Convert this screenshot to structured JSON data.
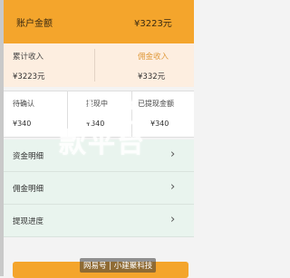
{
  "account": {
    "balance_label": "账户金额",
    "balance_value": "¥3223元"
  },
  "income": {
    "cumulative_label": "累计收入",
    "commission_label": "佣金收入",
    "cumulative_value": "¥3223元",
    "commission_value": "¥332元"
  },
  "status": [
    {
      "title": "待确认",
      "value": "¥340"
    },
    {
      "title": "提现中",
      "value": "¥340"
    },
    {
      "title": "已提现金额",
      "value": "¥340"
    }
  ],
  "menu": [
    {
      "label": "资金明细"
    },
    {
      "label": "佣金明细"
    },
    {
      "label": "提现进度"
    }
  ],
  "watermark": {
    "line1": "出 贷",
    "line2": "款平台"
  },
  "footer": {
    "credit": "网易号 | 小建聚科技"
  },
  "colors": {
    "accent": "#f4a52c",
    "commission_text": "#e09a3c",
    "menu_bg": "#e9f4ee"
  },
  "icons": {
    "chevron": "chevron-right-icon"
  }
}
